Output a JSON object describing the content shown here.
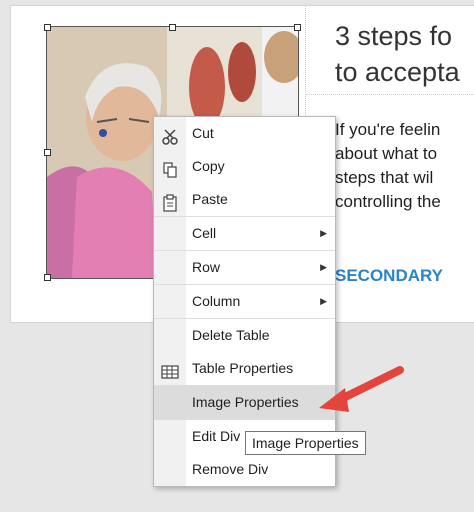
{
  "article": {
    "headline_line1": "3 steps fo",
    "headline_line2": "to accepta",
    "body_lines": [
      "If you're feelin",
      "about what to",
      "steps that wil",
      "controlling the"
    ],
    "secondary_link": "SECONDARY"
  },
  "context_menu": {
    "items": [
      {
        "label": "Cut",
        "icon": "scissors-icon"
      },
      {
        "label": "Copy",
        "icon": "copy-icon"
      },
      {
        "label": "Paste",
        "icon": "clipboard-icon"
      },
      {
        "label": "Cell",
        "submenu": true
      },
      {
        "label": "Row",
        "submenu": true
      },
      {
        "label": "Column",
        "submenu": true
      },
      {
        "label": "Delete Table"
      },
      {
        "label": "Table Properties",
        "icon": "table-icon"
      },
      {
        "label": "Image Properties",
        "highlighted": true
      },
      {
        "label": "Edit Div"
      },
      {
        "label": "Remove Div"
      }
    ]
  },
  "tooltip": {
    "text": "Image Properties"
  },
  "colors": {
    "link": "#2a84c6",
    "pointer_arrow": "#e4443e",
    "menu_highlight": "#dcdcdc"
  }
}
